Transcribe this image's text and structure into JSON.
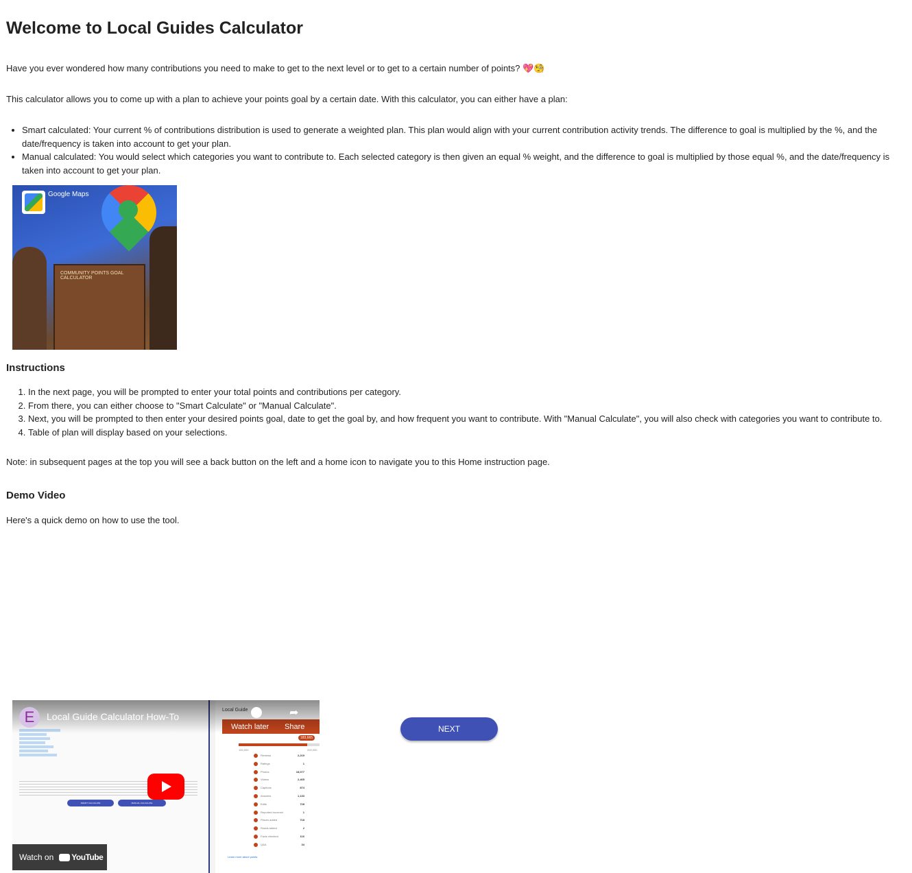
{
  "title": "Welcome to Local Guides Calculator",
  "intro": "Have you ever wondered how many contributions you need to make to get to the next level or to get to a certain number of points? 💖🧐",
  "description": "This calculator allows you to come up with a plan to achieve your points goal by a certain date. With this calculator, you can either have a plan:",
  "plans": [
    "Smart calculated: Your current % of contributions distribution is used to generate a weighted plan. This plan would align with your current contribution activity trends. The difference to goal is multiplied by the %, and the date/frequency is taken into account to get your plan.",
    "Manual calculated: You would select which categories you want to contribute to. Each selected category is then given an equal % weight, and the difference to goal is multiplied by those equal %, and the date/frequency is taken into account to get your plan."
  ],
  "hero_image": {
    "logo_text": "Google Maps",
    "box_text": "COMMUNITY POINTS GOAL CALCULATOR"
  },
  "instructions": {
    "heading": "Instructions",
    "steps": [
      "In the next page, you will be prompted to enter your total points and contributions per category.",
      "From there, you can either choose to \"Smart Calculate\" or \"Manual Calculate\".",
      "Next, you will be prompted to then enter your desired points goal, date to get the goal by, and how frequent you want to contribute. With \"Manual Calculate\", you will also check with categories you want to contribute to.",
      "Table of plan will display based on your selections."
    ]
  },
  "note": "Note: in subsequent pages at the top you will see a back button on the left and a home icon to navigate you to this Home instruction page.",
  "demo": {
    "heading": "Demo Video",
    "text": "Here's a quick demo on how to use the tool.",
    "video": {
      "title": "Local Guide Calculator How-To",
      "channel_initial": "E",
      "watch_later": "Watch later",
      "share": "Share",
      "watch_on": "Watch on",
      "youtube": "YouTube",
      "panel_title": "Local Guide",
      "points_badge": "183,665",
      "range_start": "100,000",
      "range_end": "200,000",
      "smart_btn": "SMART CALCULATE",
      "manual_btn": "MANUAL CALCULATE",
      "stats": [
        {
          "label": "Reviews",
          "value": "2,219"
        },
        {
          "label": "Ratings",
          "value": "1"
        },
        {
          "label": "Photos",
          "value": "18,077"
        },
        {
          "label": "Videos",
          "value": "2,465"
        },
        {
          "label": "Captions",
          "value": "874"
        },
        {
          "label": "Answers",
          "value": "1,133"
        },
        {
          "label": "Edits",
          "value": "728"
        },
        {
          "label": "Reported incorrect",
          "value": "1"
        },
        {
          "label": "Places added",
          "value": "718"
        },
        {
          "label": "Roads added",
          "value": "2"
        },
        {
          "label": "Facts checked",
          "value": "116"
        },
        {
          "label": "Q&A",
          "value": "34"
        }
      ],
      "learn_more": "Learn more about points"
    }
  },
  "next_label": "NEXT",
  "colors": {
    "primary": "#3f51b5",
    "youtube_red": "#ff0000",
    "panel_orange": "#c1441c"
  }
}
